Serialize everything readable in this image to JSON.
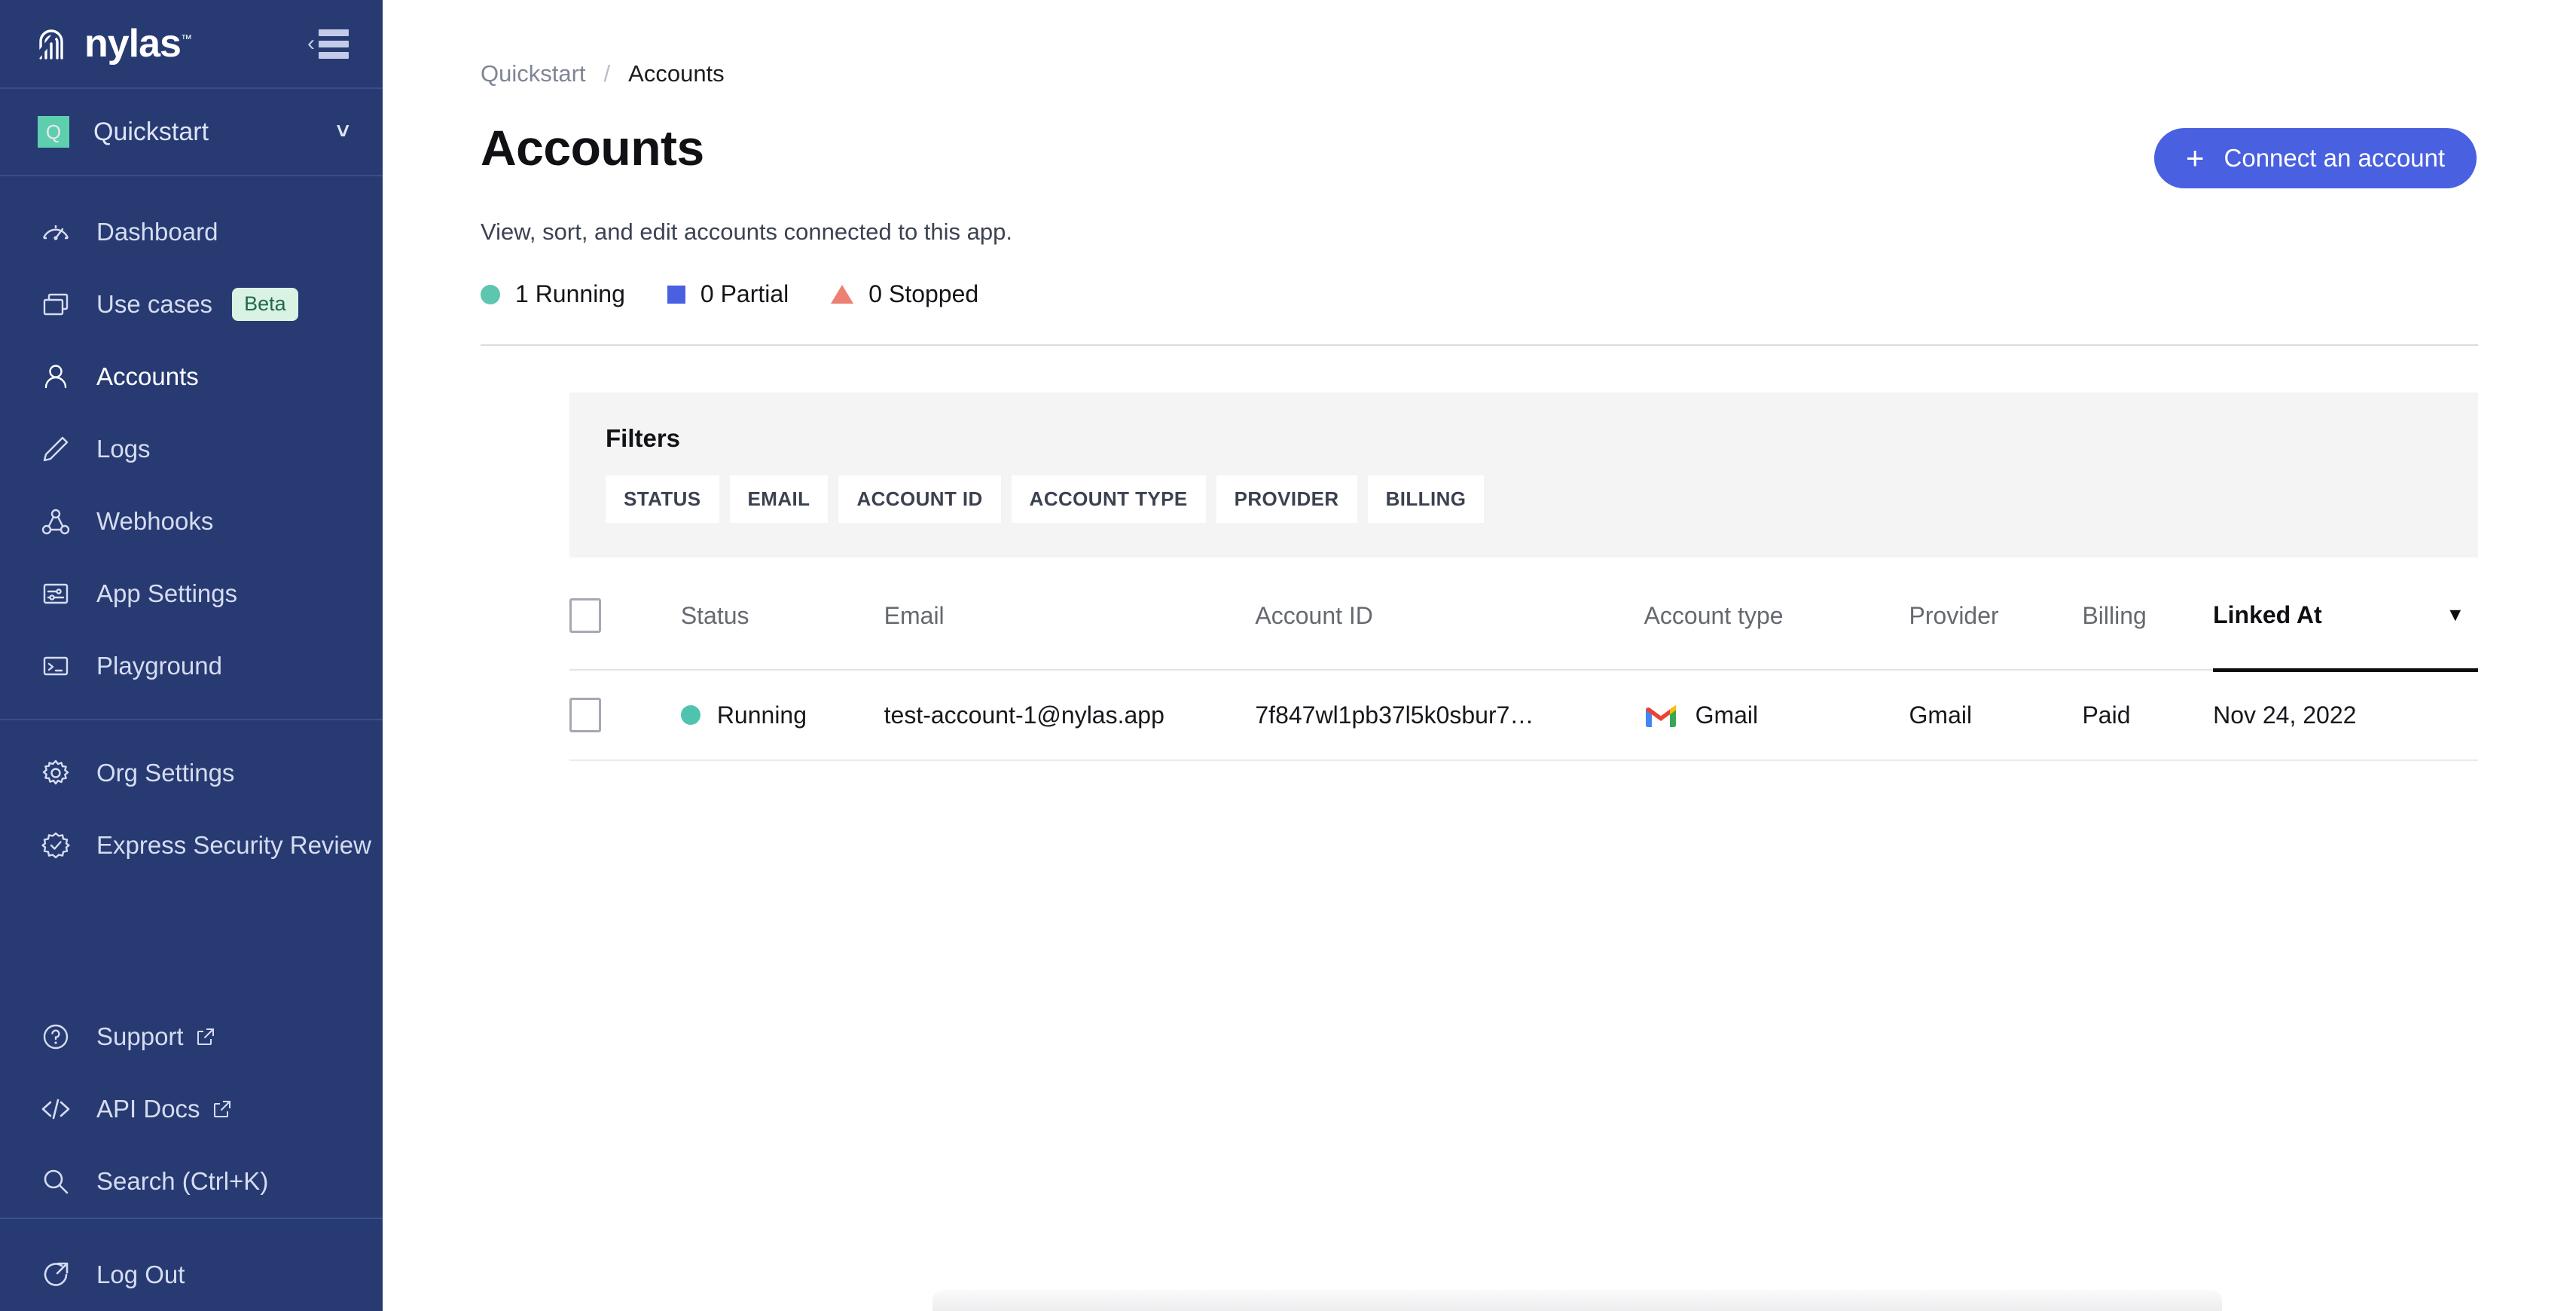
{
  "brand": {
    "logo_text": "nylas",
    "logo_tm": "™",
    "accent_blue": "#4960e0",
    "sidebar_bg": "#273a72",
    "green": "#5ecfae"
  },
  "sidebar": {
    "collapse_label": "collapse-sidebar",
    "project": {
      "initial": "Q",
      "name": "Quickstart",
      "caret": "ˇ"
    },
    "primary_items": [
      {
        "label": "Dashboard",
        "icon": "gauge-icon",
        "active": false,
        "badge": null,
        "external": false
      },
      {
        "label": "Use cases",
        "icon": "windows-icon",
        "active": false,
        "badge": "Beta",
        "external": false
      },
      {
        "label": "Accounts",
        "icon": "person-icon",
        "active": true,
        "badge": null,
        "external": false
      },
      {
        "label": "Logs",
        "icon": "pencil-icon",
        "active": false,
        "badge": null,
        "external": false
      },
      {
        "label": "Webhooks",
        "icon": "webhook-icon",
        "active": false,
        "badge": null,
        "external": false
      },
      {
        "label": "App Settings",
        "icon": "sliders-icon",
        "active": false,
        "badge": null,
        "external": false
      },
      {
        "label": "Playground",
        "icon": "terminal-icon",
        "active": false,
        "badge": null,
        "external": false
      }
    ],
    "secondary_items": [
      {
        "label": "Org Settings",
        "icon": "gear-icon",
        "external": false
      },
      {
        "label": "Express Security Review",
        "icon": "badge-check-icon",
        "external": false
      }
    ],
    "utility_items": [
      {
        "label": "Support",
        "icon": "question-circle-icon",
        "external": true
      },
      {
        "label": "API Docs",
        "icon": "code-brackets-icon",
        "external": true
      },
      {
        "label": "Search (Ctrl+K)",
        "icon": "search-icon",
        "external": false
      }
    ],
    "logout": {
      "label": "Log Out",
      "icon": "logout-icon"
    }
  },
  "breadcrumb": {
    "parent": "Quickstart",
    "separator": "/",
    "current": "Accounts"
  },
  "header": {
    "title": "Accounts",
    "subtitle": "View, sort, and edit accounts connected to this app.",
    "connect_button": {
      "label": "Connect an account",
      "plus": "+"
    }
  },
  "legend": [
    {
      "label": "1 Running",
      "shape": "circle",
      "color": "#5ec5ae"
    },
    {
      "label": "0 Partial",
      "shape": "square",
      "color": "#4960e0"
    },
    {
      "label": "0 Stopped",
      "shape": "triangle",
      "color": "#ec8072"
    }
  ],
  "filters": {
    "title": "Filters",
    "chips": [
      "STATUS",
      "EMAIL",
      "ACCOUNT ID",
      "ACCOUNT TYPE",
      "PROVIDER",
      "BILLING"
    ]
  },
  "table": {
    "columns": [
      {
        "key": "checkbox",
        "label": ""
      },
      {
        "key": "status",
        "label": "Status"
      },
      {
        "key": "email",
        "label": "Email"
      },
      {
        "key": "account_id",
        "label": "Account ID"
      },
      {
        "key": "account_type",
        "label": "Account type"
      },
      {
        "key": "provider",
        "label": "Provider"
      },
      {
        "key": "billing",
        "label": "Billing"
      },
      {
        "key": "linked_at",
        "label": "Linked At"
      }
    ],
    "sorted_column": "Linked At",
    "sort_caret": "▼",
    "rows": [
      {
        "status": "Running",
        "status_color": "#4fc3ae",
        "email": "test-account-1@nylas.app",
        "account_id": "7f847wl1pb37l5k0sbur7…",
        "account_type": "Gmail",
        "account_type_icon": "gmail-icon",
        "provider": "Gmail",
        "billing": "Paid",
        "linked_at": "Nov 24, 2022"
      }
    ]
  }
}
